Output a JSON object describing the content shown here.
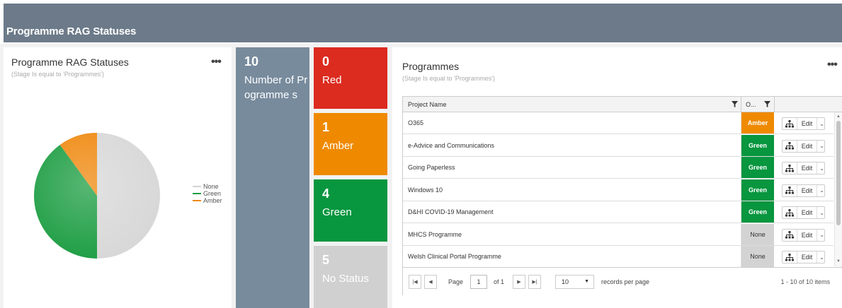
{
  "header": {
    "title": "Programme RAG Statuses"
  },
  "pie_panel": {
    "title": "Programme RAG Statuses",
    "subtitle": "(Stage Is equal to 'Programmes')",
    "menu": "•••",
    "legend": [
      {
        "label": "None",
        "color": "#d3d3d3"
      },
      {
        "label": "Green",
        "color": "#1e9e44"
      },
      {
        "label": "Amber",
        "color": "#ef8a12"
      }
    ]
  },
  "chart_data": {
    "type": "pie",
    "categories": [
      "None",
      "Green",
      "Amber"
    ],
    "values": [
      5,
      4,
      1
    ],
    "colors": [
      "#d8d8d8",
      "#1e9e44",
      "#ef8a12"
    ],
    "legend_position": "right"
  },
  "kpis": {
    "total": {
      "value": "10",
      "label": "Number of Programme s",
      "color": "#788b9d"
    },
    "red": {
      "value": "0",
      "label": "Red",
      "color": "#dc2b1f"
    },
    "amber": {
      "value": "1",
      "label": "Amber",
      "color": "#ef8a00"
    },
    "green": {
      "value": "4",
      "label": "Green",
      "color": "#08963f"
    },
    "nostatus": {
      "value": "5",
      "label": "No Status",
      "color": "#d0d0d0"
    }
  },
  "programmes": {
    "title": "Programmes",
    "subtitle": "(Stage Is equal to 'Programmes')",
    "menu": "•••",
    "columns": {
      "name": "Project Name",
      "status": "O..."
    },
    "rows": [
      {
        "name": "O365",
        "status": "Amber"
      },
      {
        "name": "e-Advice and Communications",
        "status": "Green"
      },
      {
        "name": "Going Paperless",
        "status": "Green"
      },
      {
        "name": "Windows 10",
        "status": "Green"
      },
      {
        "name": "D&HI COVID-19 Management",
        "status": "Green"
      },
      {
        "name": "MHCS Programme",
        "status": "None"
      },
      {
        "name": "Welsh Clinical Portal Programme",
        "status": "None"
      }
    ],
    "edit_label": "Edit",
    "status_colors": {
      "Amber": "#ef8a00",
      "Green": "#08963f",
      "None": "#d3d3d3"
    },
    "pager": {
      "page_label": "Page",
      "page_value": "1",
      "of_label": "of 1",
      "page_size": "10",
      "per_page_label": "records per page",
      "items_text": "1 - 10 of 10 items"
    }
  }
}
